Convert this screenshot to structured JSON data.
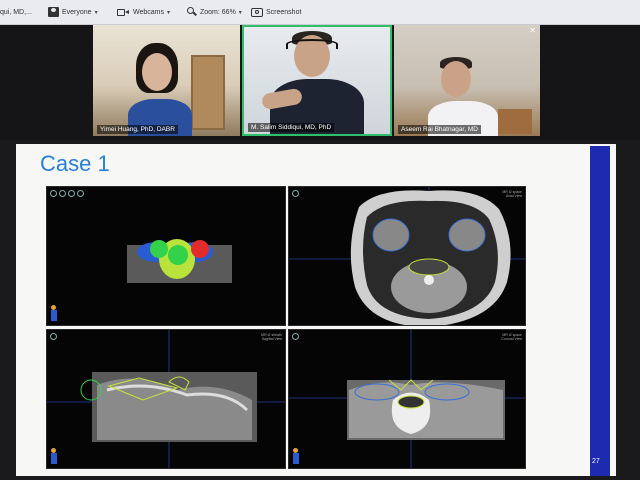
{
  "toolbar": {
    "left_text": "qui, MD,...",
    "everyone": "Everyone",
    "webcams": "Webcams",
    "zoom": "Zoom: 66%",
    "screenshot": "Screenshot"
  },
  "participants": [
    {
      "name": "Yimei Huang, PhD, DABR"
    },
    {
      "name": "M. Salim Siddiqui, MD, PhD"
    },
    {
      "name": "Aseem Rai Bhatnagar, MD"
    }
  ],
  "slide": {
    "title": "Case 1",
    "page_number": "27"
  },
  "viewers": [
    {
      "id": "3d",
      "label": ""
    },
    {
      "id": "axial",
      "label": "MR t2 space\nAxial View"
    },
    {
      "id": "sagittal",
      "label": "MR t2 sheath\nSagittal View"
    },
    {
      "id": "coronal",
      "label": "MR t2 space\nCoronal View"
    }
  ],
  "colors": {
    "slide_title": "#2a7fd6",
    "accent_bar": "#1d2bb0",
    "active_speaker_border": "#2fbf6a",
    "contour_yellow": "#c9e23a",
    "contour_blue": "#3a6fd6",
    "structure_green": "#34d24a",
    "structure_red": "#e22b2b"
  }
}
